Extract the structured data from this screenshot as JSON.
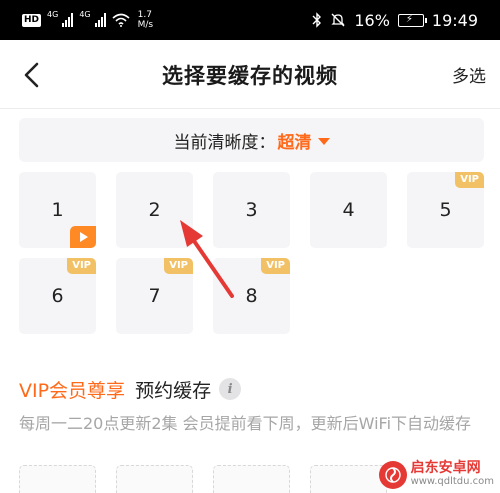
{
  "status_bar": {
    "hd": "HD",
    "sim1": "4G",
    "sim2": "4G",
    "speed_value": "1.7",
    "speed_unit": "M/s",
    "battery": "16%",
    "time": "19:49"
  },
  "header": {
    "title": "选择要缓存的视频",
    "multi_select": "多选"
  },
  "quality": {
    "label": "当前清晰度：",
    "value": "超清"
  },
  "episodes": [
    {
      "label": "1",
      "badge": "playing"
    },
    {
      "label": "2",
      "badge": ""
    },
    {
      "label": "3",
      "badge": ""
    },
    {
      "label": "4",
      "badge": ""
    },
    {
      "label": "5",
      "badge": "VIP"
    },
    {
      "label": "6",
      "badge": "VIP"
    },
    {
      "label": "7",
      "badge": "VIP"
    },
    {
      "label": "8",
      "badge": "VIP"
    }
  ],
  "vip_section": {
    "title_orange": "VIP会员尊享",
    "title_black": "预约缓存",
    "info": "i",
    "description": "每周一二20点更新2集 会员提前看下周，更新后WiFi下自动缓存"
  },
  "watermark": {
    "name": "启东安卓网",
    "url": "www.qdltdu.com"
  },
  "colors": {
    "accent": "#ff6a1a",
    "vip_badge": "#f2c165",
    "playing_badge": "#ff8a25",
    "tile_bg": "#f5f5f7",
    "arrow": "#e53935"
  }
}
